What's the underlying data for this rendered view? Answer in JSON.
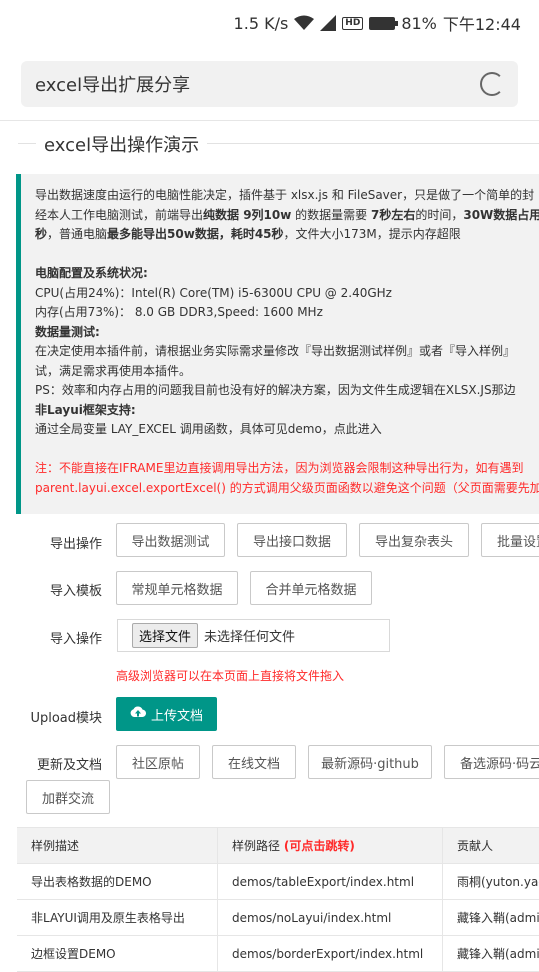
{
  "status": {
    "speed": "1.5 K/s",
    "battery": "81%",
    "time": "下午12:44",
    "hd": "HD"
  },
  "address": {
    "text": "excel导出扩展分享"
  },
  "section_title": "excel导出操作演示",
  "notice": {
    "p1a": "导出数据速度由运行的电脑性能决定，插件基于 xlsx.js 和 FileSaver，只是做了一个简单的封",
    "p1b_1": "经本人工作电脑测试，前端导出",
    "p1b_2": "纯数据 9列10w",
    "p1b_3": " 的数据量需要 ",
    "p1b_4": "7秒左右",
    "p1b_5": "的时间，",
    "p1b_6": "30W数据占用",
    "p1c_1": "秒",
    "p1c_2": "，普通电脑",
    "p1c_3": "最多能导出50w数据，耗时45秒",
    "p1c_4": "，文件大小173M，提示内存超限",
    "cfg_title": "电脑配置及系统状况:",
    "cpu": "CPU(占用24%)：Intel(R) Core(TM) i5-6300U CPU @ 2.40GHz",
    "mem": "内存(占用73%)： 8.0 GB DDR3,Speed: 1600 MHz",
    "test_title": "数据量测试:",
    "test1": "在决定使用本插件前，请根据业务实际需求量修改『导出数据测试样例』或者『导入样例』",
    "test2": "试，满足需求再使用本插件。",
    "ps": "PS：效率和内存占用的问题我目前也没有好的解决方案，因为文件生成逻辑在XLSX.JS那边",
    "nonlayui_title": "非Layui框架支持:",
    "nonlayui": "通过全局变量 LAY_EXCEL 调用函数，具体可见demo，点此进入",
    "warn1": "注：不能直接在IFRAME里边直接调用导出方法，因为浏览器会限制这种导出行为，如有遇到",
    "warn2": "parent.layui.excel.exportExcel() 的方式调用父级页面函数以避免这个问题（父页面需要先加"
  },
  "export_ops": {
    "label": "导出操作",
    "buttons": [
      "导出数据测试",
      "导出接口数据",
      "导出复杂表头",
      "批量设置"
    ]
  },
  "import_tpl": {
    "label": "导入模板",
    "buttons": [
      "常规单元格数据",
      "合并单元格数据"
    ]
  },
  "import_ops": {
    "label": "导入操作",
    "choose": "选择文件",
    "no_file": "未选择任何文件",
    "hint": "高级浏览器可以在本页面上直接将文件拖入"
  },
  "upload": {
    "label": "Upload模块",
    "button": "上传文档"
  },
  "docs": {
    "label": "更新及文档",
    "buttons": [
      "社区原帖",
      "在线文档",
      "最新源码·github",
      "备选源码·码云"
    ],
    "extra": "加群交流"
  },
  "table": {
    "headers": {
      "desc": "样例描述",
      "path": "样例路径",
      "path_hint": "(可点击跳转)",
      "author": "贡献人"
    },
    "rows": [
      {
        "desc": "导出表格数据的DEMO",
        "path": "demos/tableExport/index.html",
        "author": "雨桐(yuton.yao"
      },
      {
        "desc": "非LAYUI调用及原生表格导出",
        "path": "demos/noLayui/index.html",
        "author": "藏锋入鞘(admi"
      },
      {
        "desc": "边框设置DEMO",
        "path": "demos/borderExport/index.html",
        "author": "藏锋入鞘(admi"
      }
    ]
  },
  "colors": {
    "accent": "#009688",
    "warning": "#ff2a2a"
  }
}
